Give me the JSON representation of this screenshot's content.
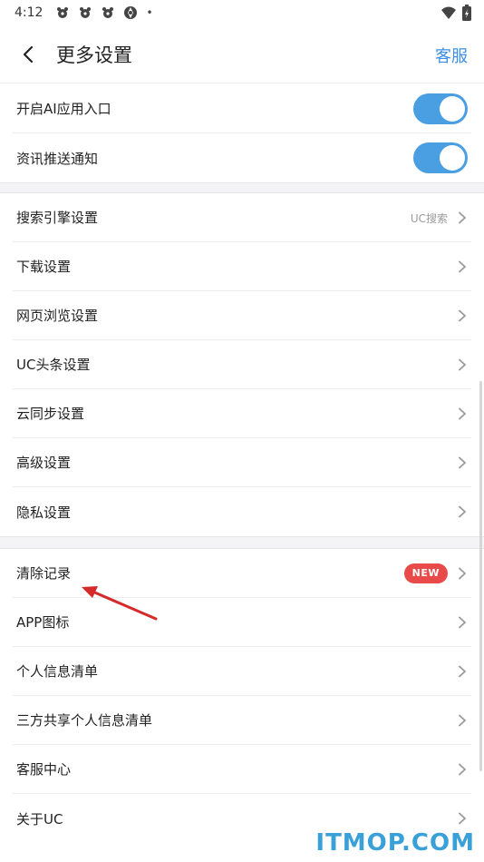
{
  "status_bar": {
    "time": "4:12",
    "dot": "•"
  },
  "header": {
    "title": "更多设置",
    "service_label": "客服"
  },
  "toggles": [
    {
      "label": "开启AI应用入口",
      "on": true
    },
    {
      "label": "资讯推送通知",
      "on": true
    }
  ],
  "settings": [
    {
      "label": "搜索引擎设置",
      "value": "UC搜索"
    },
    {
      "label": "下载设置"
    },
    {
      "label": "网页浏览设置"
    },
    {
      "label": "UC头条设置"
    },
    {
      "label": "云同步设置"
    },
    {
      "label": "高级设置"
    },
    {
      "label": "隐私设置"
    }
  ],
  "more": [
    {
      "label": "清除记录",
      "badge": "NEW"
    },
    {
      "label": "APP图标"
    },
    {
      "label": "个人信息清单"
    },
    {
      "label": "三方共享个人信息清单"
    },
    {
      "label": "客服中心"
    },
    {
      "label": "关于UC"
    }
  ],
  "watermark": "ITMOP.COM",
  "colors": {
    "accent": "#3d8fe5",
    "toggle_on": "#4a9fe3",
    "badge": "#e84a4a",
    "annotation_arrow": "#d42a2a"
  }
}
